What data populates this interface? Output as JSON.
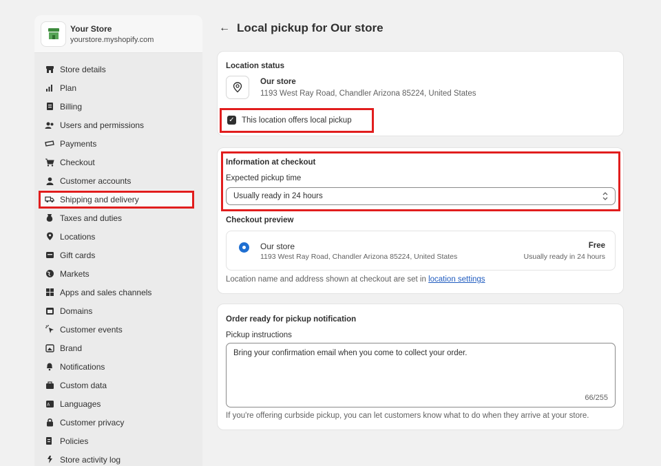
{
  "store": {
    "name": "Your Store",
    "url": "yourstore.myshopify.com"
  },
  "sidebar": {
    "items": [
      {
        "label": "Store details",
        "icon": "store-icon"
      },
      {
        "label": "Plan",
        "icon": "plan-icon"
      },
      {
        "label": "Billing",
        "icon": "billing-icon"
      },
      {
        "label": "Users and permissions",
        "icon": "users-icon"
      },
      {
        "label": "Payments",
        "icon": "payments-icon"
      },
      {
        "label": "Checkout",
        "icon": "cart-icon"
      },
      {
        "label": "Customer accounts",
        "icon": "person-icon"
      },
      {
        "label": "Shipping and delivery",
        "icon": "truck-icon",
        "active": true
      },
      {
        "label": "Taxes and duties",
        "icon": "taxes-icon"
      },
      {
        "label": "Locations",
        "icon": "location-icon"
      },
      {
        "label": "Gift cards",
        "icon": "gift-card-icon"
      },
      {
        "label": "Markets",
        "icon": "globe-icon"
      },
      {
        "label": "Apps and sales channels",
        "icon": "apps-icon"
      },
      {
        "label": "Domains",
        "icon": "domains-icon"
      },
      {
        "label": "Customer events",
        "icon": "cursor-icon"
      },
      {
        "label": "Brand",
        "icon": "brand-icon"
      },
      {
        "label": "Notifications",
        "icon": "bell-icon"
      },
      {
        "label": "Custom data",
        "icon": "custom-data-icon"
      },
      {
        "label": "Languages",
        "icon": "language-icon"
      },
      {
        "label": "Customer privacy",
        "icon": "lock-icon"
      },
      {
        "label": "Policies",
        "icon": "policies-icon"
      },
      {
        "label": "Store activity log",
        "icon": "activity-icon"
      }
    ]
  },
  "page": {
    "title": "Local pickup for Our store"
  },
  "location_status": {
    "title": "Location status",
    "location_name": "Our store",
    "address": "1193 West Ray Road, Chandler Arizona 85224, United States",
    "checkbox_label": "This location offers local pickup",
    "checked": true
  },
  "checkout_info": {
    "title": "Information at checkout",
    "pickup_time_label": "Expected pickup time",
    "pickup_time_value": "Usually ready in 24 hours",
    "preview_title": "Checkout preview",
    "preview_name": "Our store",
    "preview_address": "1193 West Ray Road, Chandler Arizona 85224, United States",
    "preview_price": "Free",
    "preview_ready": "Usually ready in 24 hours",
    "footer_text": "Location name and address shown at checkout are set in",
    "footer_link": "location settings"
  },
  "notification": {
    "title": "Order ready for pickup notification",
    "instructions_label": "Pickup instructions",
    "instructions_value": "Bring your confirmation email when you come to collect your order.",
    "counter": "66/255",
    "help_text": "If you're offering curbside pickup, you can let customers know what to do when they arrive at your store."
  },
  "colors": {
    "highlight": "#e11d1d",
    "accent": "#1f6fd1",
    "link": "#1f5bbf"
  }
}
